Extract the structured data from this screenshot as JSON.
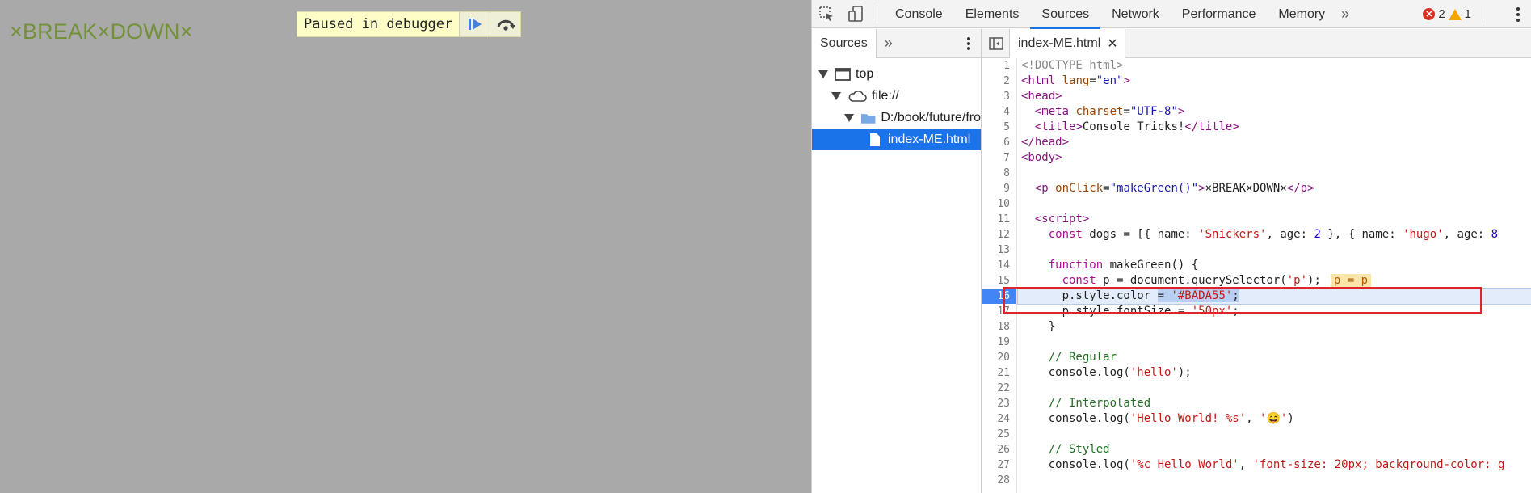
{
  "page": {
    "text": "×BREAK×DOWN×",
    "text_color": "#74913a",
    "paused_label": "Paused in debugger"
  },
  "devtools": {
    "tabs": [
      "Console",
      "Elements",
      "Sources",
      "Network",
      "Performance",
      "Memory"
    ],
    "active_tab": "Sources",
    "error_count": "2",
    "warning_count": "1",
    "navigator": {
      "tab_label": "Sources",
      "tree": [
        {
          "label": "top",
          "kind": "frame"
        },
        {
          "label": "file://",
          "kind": "cloud"
        },
        {
          "label": "D:/book/future/fro",
          "kind": "folder"
        },
        {
          "label": "index-ME.html",
          "kind": "file",
          "selected": true
        }
      ]
    },
    "editor": {
      "open_file": "index-ME.html",
      "execution_line": 16,
      "line_numbers": [
        "1",
        "2",
        "3",
        "4",
        "5",
        "6",
        "7",
        "8",
        "9",
        "10",
        "11",
        "12",
        "13",
        "14",
        "15",
        "16",
        "17",
        "18",
        "19",
        "20",
        "21",
        "22",
        "23",
        "24",
        "25",
        "26",
        "27",
        "28"
      ],
      "code_lines": [
        "<!DOCTYPE html>",
        "<html lang=\"en\">",
        "<head>",
        "  <meta charset=\"UTF-8\">",
        "  <title>Console Tricks!</title>",
        "</head>",
        "<body>",
        "",
        "  <p onClick=\"makeGreen()\">×BREAK×DOWN×</p>",
        "",
        "  <script>",
        "    const dogs = [{ name: 'Snickers', age: 2 }, { name: 'hugo', age: 8",
        "",
        "    function makeGreen() {",
        "      const p = document.querySelector('p');",
        "      p.style.color = '#BADA55';",
        "      p.style.fontSize = '50px';",
        "    }",
        "",
        "    // Regular",
        "    console.log('hello');",
        "",
        "    // Interpolated",
        "    console.log('Hello World! %s', '😄')",
        "",
        "    // Styled",
        "    console.log('%c Hello World', 'font-size: 20px; background-color: g",
        ""
      ],
      "inline_value": "p = p"
    }
  }
}
